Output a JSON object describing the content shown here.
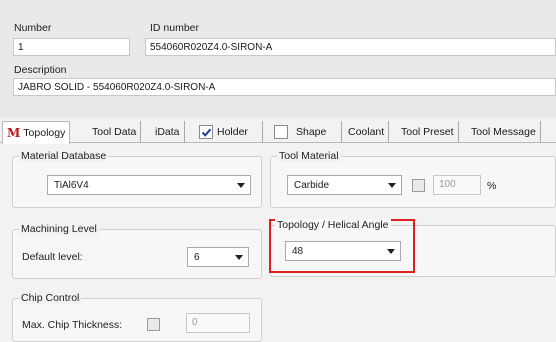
{
  "header": {
    "number_label": "Number",
    "number_value": "1",
    "id_label": "ID number",
    "id_value": "554060R020Z4.0-SIRON-A",
    "description_label": "Description",
    "description_value": "JABRO SOLID - 554060R020Z4.0-SIRON-A"
  },
  "tabs": [
    {
      "icon": "M",
      "label": "Topology"
    },
    {
      "label": "Tool Data"
    },
    {
      "label": "iData"
    },
    {
      "label": "Holder",
      "checked": true
    },
    {
      "label": "Shape",
      "checked": false
    },
    {
      "label": "Coolant"
    },
    {
      "label": "Tool Preset"
    },
    {
      "label": "Tool Message"
    }
  ],
  "material_database": {
    "title": "Material Database",
    "value": "TiAl6V4"
  },
  "tool_material": {
    "title": "Tool Material",
    "value": "Carbide",
    "percent_value": "100",
    "percent_unit": "%"
  },
  "machining_level": {
    "title": "Machining Level",
    "default_label": "Default level:",
    "default_value": "6"
  },
  "helical_angle": {
    "title": "Topology / Helical Angle",
    "value": "48",
    "highlight_color": "#e02020"
  },
  "chip_control": {
    "title": "Chip Control",
    "label": "Max. Chip Thickness:",
    "value": "0"
  }
}
